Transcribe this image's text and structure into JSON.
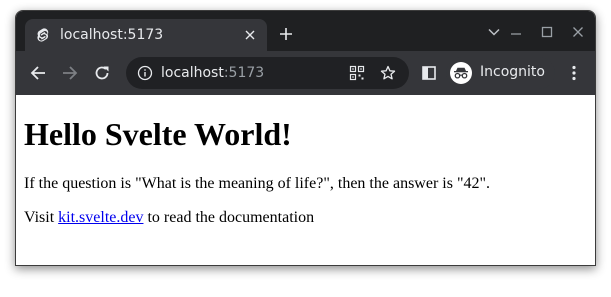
{
  "tab": {
    "title": "localhost:5173",
    "favicon": "svelte-icon"
  },
  "address_bar": {
    "host": "localhost",
    "port": ":5173"
  },
  "profile": {
    "label": "Incognito"
  },
  "page": {
    "heading": "Hello Svelte World!",
    "paragraph1": "If the question is \"What is the meaning of life?\", then the answer is \"42\".",
    "paragraph2_before": "Visit ",
    "link_text": "kit.svelte.dev",
    "paragraph2_after": " to read the documentation"
  },
  "colors": {
    "titlebar": "#1f2022",
    "toolbar": "#35363a",
    "omnibox": "#202124",
    "link": "#0000ee"
  }
}
